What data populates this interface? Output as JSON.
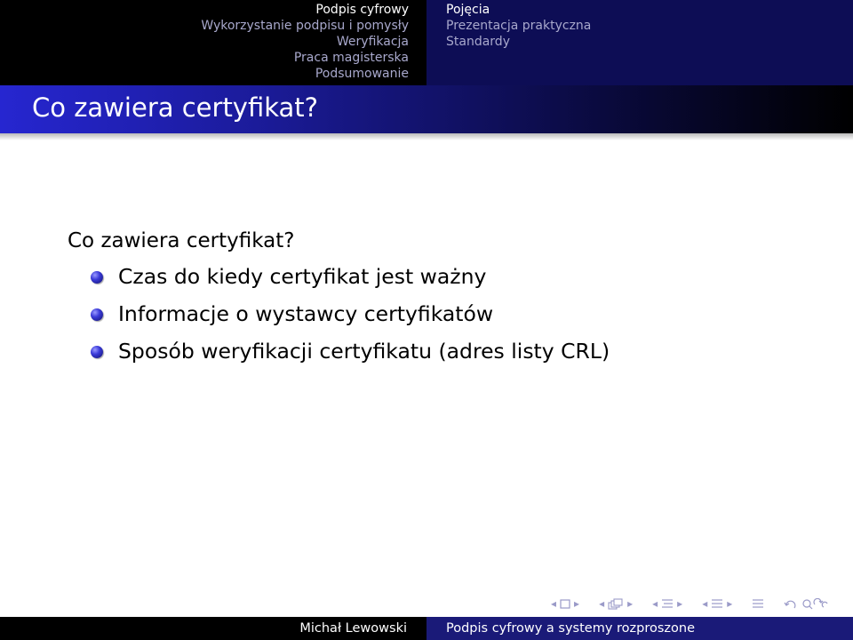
{
  "nav": {
    "sections_left": [
      {
        "label": "Podpis cyfrowy",
        "current": true
      },
      {
        "label": "Wykorzystanie podpisu i pomysły",
        "current": false
      },
      {
        "label": "Weryfikacja",
        "current": false
      },
      {
        "label": "Praca magisterska",
        "current": false
      },
      {
        "label": "Podsumowanie",
        "current": false
      }
    ],
    "subsections_right": [
      {
        "label": "Pojęcia",
        "current": true
      },
      {
        "label": "Prezentacja praktyczna",
        "current": false
      },
      {
        "label": "Standardy",
        "current": false
      }
    ]
  },
  "frame": {
    "title": "Co zawiera certyfikat?"
  },
  "content": {
    "heading": "Co zawiera certyfikat?",
    "bullets": [
      "Czas do kiedy certyfikat jest ważny",
      "Informacje o wystawcy certyfikatów",
      "Sposób weryfikacji certyfikatu (adres listy CRL)"
    ]
  },
  "footer": {
    "author": "Michał Lewowski",
    "title": "Podpis cyfrowy a systemy rozproszone"
  },
  "icons": {
    "nav_symbols": [
      "slide-prev-icon",
      "slide-icon",
      "slide-next-icon",
      "frame-prev-icon",
      "frame-icon",
      "frame-next-icon",
      "subsection-prev-icon",
      "subsection-icon",
      "subsection-next-icon",
      "section-prev-icon",
      "section-icon",
      "section-next-icon",
      "appendix-icon",
      "back-icon",
      "search-icon"
    ]
  },
  "colors": {
    "title_gradient_start": "#2626d0",
    "nav_right_bg": "#0d0d55",
    "footer_right_bg": "#1a1a78",
    "bullet": "#3a3ad8"
  }
}
